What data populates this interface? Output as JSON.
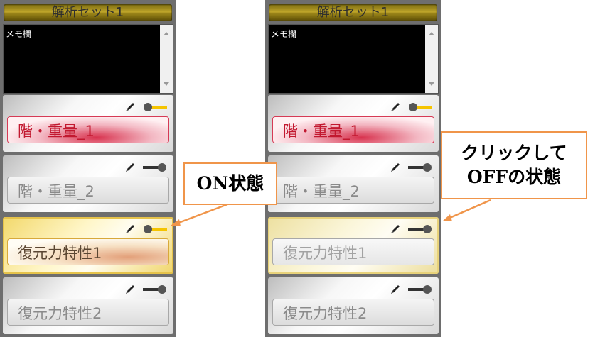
{
  "left_panel": {
    "title": "解析セット1",
    "memo_label": "メモ欄",
    "cards": [
      {
        "label": "階・重量_1",
        "toggle_state": "on"
      },
      {
        "label": "階・重量_2",
        "toggle_state": "off"
      },
      {
        "label": "復元力特性1",
        "toggle_state": "on"
      },
      {
        "label": "復元力特性2",
        "toggle_state": "off"
      }
    ]
  },
  "right_panel": {
    "title": "解析セット1",
    "memo_label": "メモ欄",
    "cards": [
      {
        "label": "階・重量_1",
        "toggle_state": "on"
      },
      {
        "label": "階・重量_2",
        "toggle_state": "off"
      },
      {
        "label": "復元力特性1",
        "toggle_state": "off"
      },
      {
        "label": "復元力特性2",
        "toggle_state": "off"
      }
    ]
  },
  "callouts": {
    "on_state": "ON状態",
    "off_state_line1": "クリックして",
    "off_state_line2": "OFFの状態"
  },
  "colors": {
    "callout_border": "#f0954a",
    "toggle_on": "#f5c400",
    "active_red": "#c2182f",
    "active_yellow": "#e6c34a"
  },
  "icons": [
    "pencil-icon",
    "toggle-switch-icon",
    "scroll-up-arrow-icon",
    "scroll-down-arrow-icon"
  ]
}
